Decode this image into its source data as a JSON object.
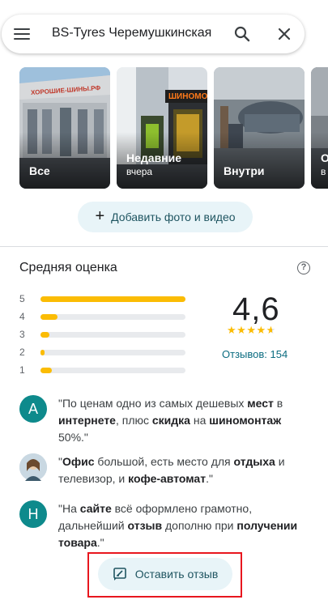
{
  "search": {
    "query": "BS-Tyres Черемушкинская"
  },
  "photos": [
    {
      "title": "Все",
      "subtitle": ""
    },
    {
      "title": "Недавние",
      "subtitle": "вчера"
    },
    {
      "title": "Внутри",
      "subtitle": ""
    },
    {
      "title": "О",
      "subtitle": "в"
    }
  ],
  "photo_signs": {
    "left_sign": "ХОРОШИЕ-ШИНЫ.РФ",
    "middle_sign": "ШИНОМОНТ"
  },
  "add_photo_label": "Добавить фото и видео",
  "rating": {
    "title": "Средняя оценка",
    "score": "4,6",
    "stars_value": 4.6,
    "reviews_label": "Отзывов: 154",
    "distribution": [
      {
        "stars": "5",
        "fraction": 1.0
      },
      {
        "stars": "4",
        "fraction": 0.12
      },
      {
        "stars": "3",
        "fraction": 0.06
      },
      {
        "stars": "2",
        "fraction": 0.02
      },
      {
        "stars": "1",
        "fraction": 0.08
      }
    ]
  },
  "snippets": [
    {
      "avatar_letter": "A",
      "avatar_color": "#0e8a8c",
      "parts": [
        {
          "t": "\"По ценам одно из самых дешевых ",
          "b": false
        },
        {
          "t": "мест",
          "b": true
        },
        {
          "t": " в ",
          "b": false
        },
        {
          "t": "интернете",
          "b": true
        },
        {
          "t": ", плюс ",
          "b": false
        },
        {
          "t": "скидка",
          "b": true
        },
        {
          "t": " на ",
          "b": false
        },
        {
          "t": "шиномонтаж",
          "b": true
        },
        {
          "t": " 50%.\"",
          "b": false
        }
      ]
    },
    {
      "avatar_letter": "",
      "avatar_color": "#b7c9d6",
      "parts": [
        {
          "t": "\"",
          "b": false
        },
        {
          "t": "Офис",
          "b": true
        },
        {
          "t": " большой, есть место для ",
          "b": false
        },
        {
          "t": "отдыха",
          "b": true
        },
        {
          "t": " и телевизор, и ",
          "b": false
        },
        {
          "t": "кофе-автомат",
          "b": true
        },
        {
          "t": ".\"",
          "b": false
        }
      ]
    },
    {
      "avatar_letter": "H",
      "avatar_color": "#0e8a8c",
      "parts": [
        {
          "t": "\"На ",
          "b": false
        },
        {
          "t": "сайте",
          "b": true
        },
        {
          "t": " всё оформлено грамотно, дальнейший ",
          "b": false
        },
        {
          "t": "отзыв",
          "b": true
        },
        {
          "t": " дополню при ",
          "b": false
        },
        {
          "t": "получении товара",
          "b": true
        },
        {
          "t": ".\"",
          "b": false
        }
      ]
    }
  ],
  "write_review_label": "Оставить отзыв",
  "colors": {
    "accent": "#0b6c80",
    "star": "#fbbc04",
    "highlight": "#e8161e",
    "pill_bg": "#e8f4f8"
  }
}
